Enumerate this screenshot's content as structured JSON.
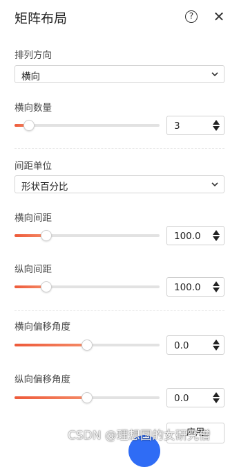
{
  "panel": {
    "title": "矩阵布局",
    "help_glyph": "?",
    "close_glyph": "✕"
  },
  "arrangement": {
    "label": "排列方向",
    "value": "横向"
  },
  "horizontal_count": {
    "label": "横向数量",
    "value": "3",
    "slider_fraction": 0.1
  },
  "spacing_unit": {
    "label": "间距单位",
    "value": "形状百分比"
  },
  "horizontal_spacing": {
    "label": "横向间距",
    "value": "100.0",
    "slider_fraction": 0.22
  },
  "vertical_spacing": {
    "label": "纵向间距",
    "value": "100.0",
    "slider_fraction": 0.22
  },
  "horizontal_offset": {
    "label": "横向偏移角度",
    "value": "0.0",
    "slider_fraction": 0.5
  },
  "vertical_offset": {
    "label": "纵向偏移角度",
    "value": "0.0",
    "slider_fraction": 0.5
  },
  "apply_button_label": "应用",
  "watermark": "CSDN @理想国的女研究僧",
  "colors": {
    "accent_fill": "#ee5a3a",
    "fab_blue": "#2f6cf5"
  }
}
